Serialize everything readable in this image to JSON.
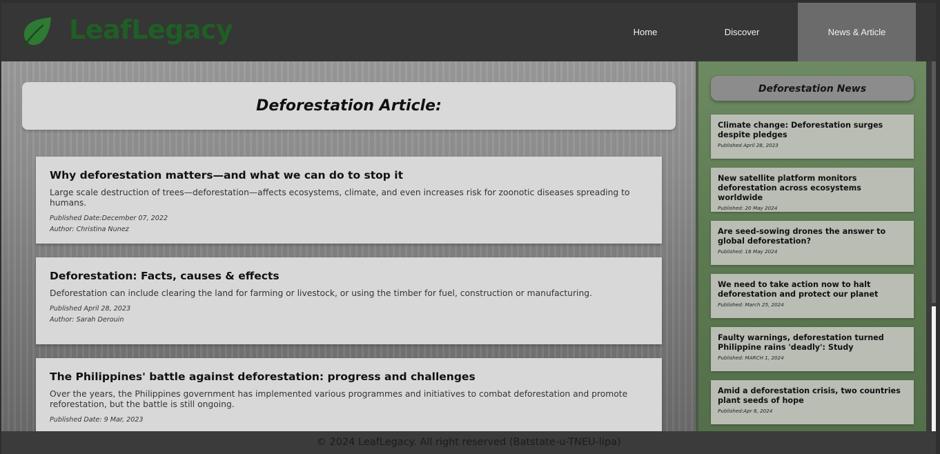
{
  "brand": {
    "name": "LeafLegacy",
    "color": "#1f5e25"
  },
  "nav": {
    "items": [
      {
        "label": "Home"
      },
      {
        "label": "Discover"
      },
      {
        "label": "News & Article",
        "active": true
      }
    ]
  },
  "main": {
    "title": "Deforestation Article:",
    "articles": [
      {
        "title": "Why deforestation matters—and what we can do to stop it",
        "summary": "Large scale destruction of trees—deforestation—affects ecosystems, climate, and even increases risk for zoonotic diseases spreading to humans.",
        "published": "Published Date:December 07, 2022",
        "author": "Author: Christina Nunez"
      },
      {
        "title": "Deforestation: Facts, causes & effects",
        "summary": "Deforestation can include clearing the land for farming or livestock, or using the timber for fuel, construction or manufacturing.",
        "published": "Published April 28, 2023",
        "author": "Author: Sarah Derouin"
      },
      {
        "title": "The Philippines' battle against deforestation: progress and challenges",
        "summary": "Over the years, the Philippines government has implemented various programmes and initiatives to combat deforestation and promote reforestation, but the battle is still ongoing.",
        "published": "Published Date: 9 Mar, 2023",
        "author": ""
      }
    ]
  },
  "sidebar": {
    "title": "Deforestation News",
    "news": [
      {
        "title": "Climate change: Deforestation surges despite pledges",
        "date": "Published April 28, 2023"
      },
      {
        "title": "New satellite platform monitors deforestation across ecosystems worldwide",
        "date": "Published: 20 May 2024"
      },
      {
        "title": "Are seed-sowing drones the answer to global deforestation?",
        "date": "Published: 18 May 2024"
      },
      {
        "title": "We need to take action now to halt deforestation and protect our planet",
        "date": "Published: March 25, 2024"
      },
      {
        "title": "Faulty warnings, deforestation turned Philippine rains 'deadly': Study",
        "date": "Published: MARCH 1, 2024"
      },
      {
        "title": "Amid a deforestation crisis, two countries plant seeds of hope",
        "date": "Published:Apr 8, 2024"
      }
    ]
  },
  "footer": {
    "text": "© 2024 LeafLegacy. All right reserved (Batstate-u-TNEU-lipa)"
  }
}
